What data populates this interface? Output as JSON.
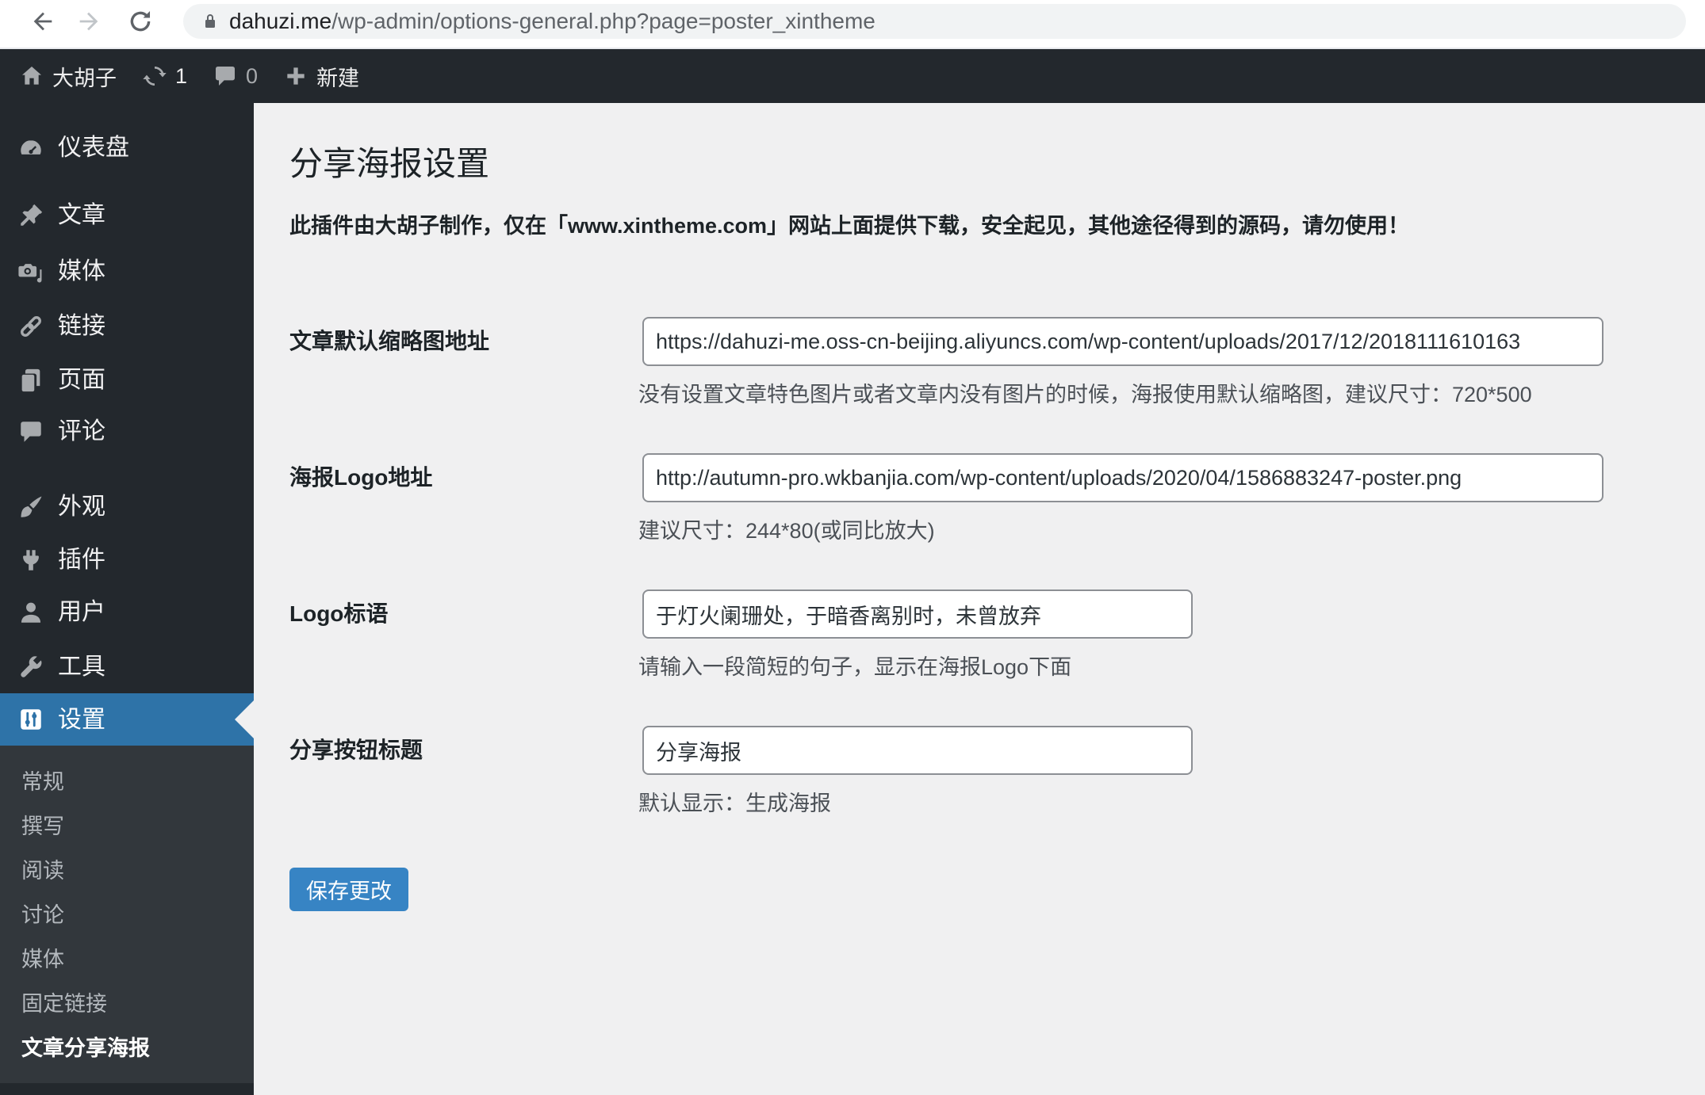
{
  "browser": {
    "url_host": "dahuzi.me",
    "url_path": "/wp-admin/options-general.php?page=poster_xintheme"
  },
  "admin_bar": {
    "site_name": "大胡子",
    "update_count": "1",
    "comment_count": "0",
    "new_label": "新建"
  },
  "sidebar": {
    "items": [
      {
        "icon": "dashboard-icon",
        "label": "仪表盘"
      },
      {
        "icon": "posts-icon",
        "label": "文章"
      },
      {
        "icon": "media-icon",
        "label": "媒体"
      },
      {
        "icon": "links-icon",
        "label": "链接"
      },
      {
        "icon": "pages-icon",
        "label": "页面"
      },
      {
        "icon": "comments-icon",
        "label": "评论"
      },
      {
        "icon": "appearance-icon",
        "label": "外观"
      },
      {
        "icon": "plugins-icon",
        "label": "插件"
      },
      {
        "icon": "users-icon",
        "label": "用户"
      },
      {
        "icon": "tools-icon",
        "label": "工具"
      },
      {
        "icon": "settings-icon",
        "label": "设置",
        "active": true
      }
    ],
    "submenu": [
      {
        "label": "常规"
      },
      {
        "label": "撰写"
      },
      {
        "label": "阅读"
      },
      {
        "label": "讨论"
      },
      {
        "label": "媒体"
      },
      {
        "label": "固定链接"
      },
      {
        "label": "文章分享海报",
        "current": true
      }
    ]
  },
  "main": {
    "title": "分享海报设置",
    "notice": "此插件由大胡子制作，仅在「www.xintheme.com」网站上面提供下载，安全起见，其他途径得到的源码，请勿使用！",
    "fields": [
      {
        "label": "文章默认缩略图地址",
        "value": "https://dahuzi-me.oss-cn-beijing.aliyuncs.com/wp-content/uploads/2017/12/2018111610163",
        "help": "没有设置文章特色图片或者文章内没有图片的时候，海报使用默认缩略图，建议尺寸：720*500"
      },
      {
        "label": "海报Logo地址",
        "value": "http://autumn-pro.wkbanjia.com/wp-content/uploads/2020/04/1586883247-poster.png",
        "help": "建议尺寸：244*80(或同比放大)"
      },
      {
        "label": "Logo标语",
        "value": "于灯火阑珊处，于暗香离别时，未曾放弃",
        "help": "请输入一段简短的句子，显示在海报Logo下面"
      },
      {
        "label": "分享按钮标题",
        "value": "分享海报",
        "help": "默认显示：生成海报"
      }
    ],
    "save_label": "保存更改"
  },
  "colors": {
    "admin_bar_bg": "#23282d",
    "sidebar_bg": "#23282d",
    "submenu_bg": "#32373c",
    "menu_active": "#2e73a8",
    "content_bg": "#f0f0f1",
    "button": "#3784c4",
    "input_border": "#8c8f94"
  }
}
